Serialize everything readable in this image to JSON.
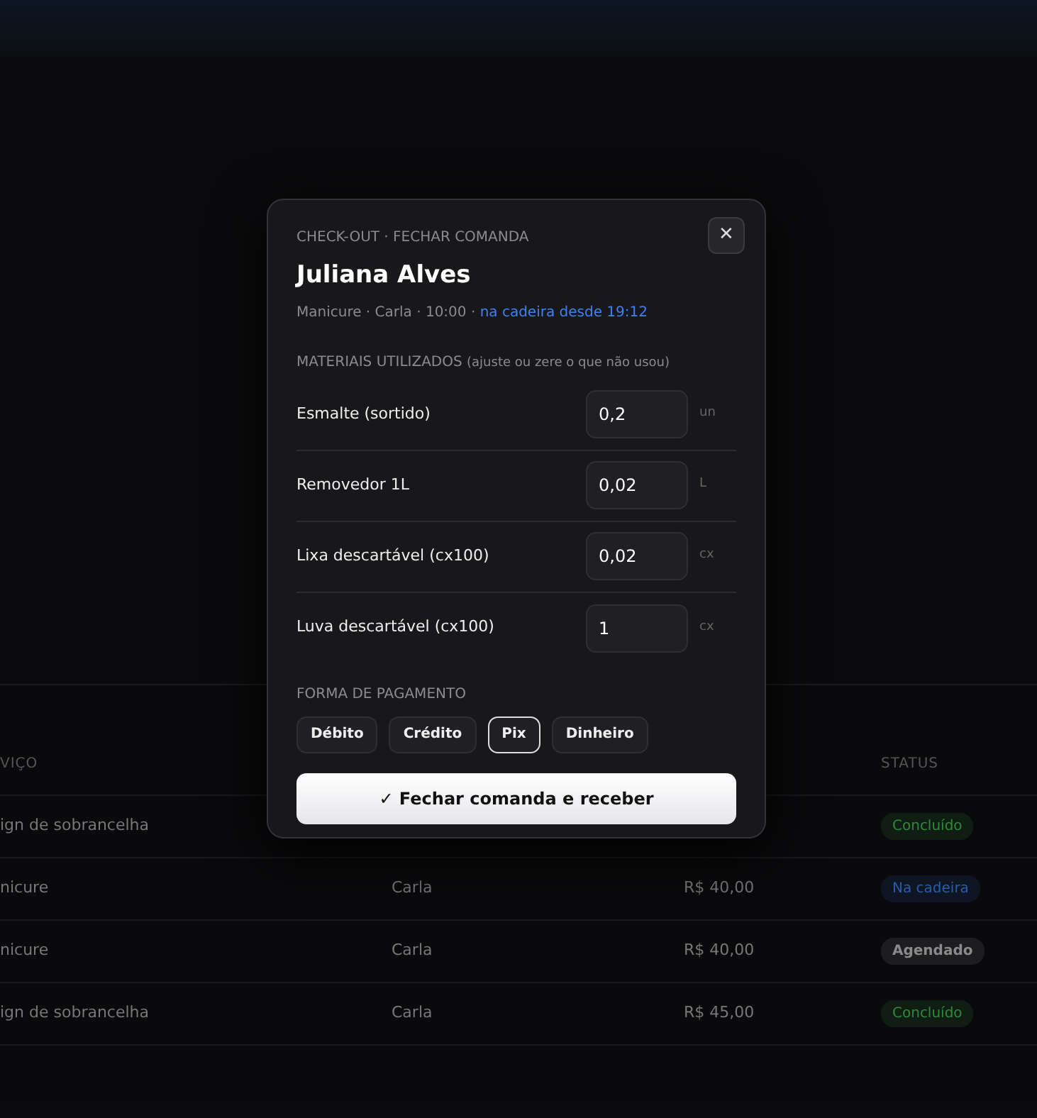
{
  "table": {
    "columns": [
      "VIÇO",
      "STATUS"
    ],
    "rows": [
      {
        "service": "ign de sobrancelha",
        "status": "Concluído",
        "color": "#2f8a3a"
      },
      {
        "service": "nicure",
        "professional": "Carla",
        "price": "R$ 40,00",
        "status": "Na cadeira",
        "color": "#2a5da8"
      },
      {
        "service": "nicure",
        "professional": "Carla",
        "price": "R$ 40,00",
        "status": "Agendado",
        "color": "#8a8a8a"
      },
      {
        "service": "ign de sobrancelha",
        "professional": "Carla",
        "price": "R$ 45,00",
        "status": "Concluído",
        "color": "#2f8a3a"
      }
    ]
  },
  "modal": {
    "kicker": "CHECK-OUT · FECHAR COMANDA",
    "close": "✕",
    "client": "Juliana Alves",
    "meta": "Manicure · Carla · 10:00 · ",
    "meta_highlight": "na cadeira desde 19:12",
    "materials_title": "MATERIAIS UTILIZADOS",
    "materials_hint": "(ajuste ou zere o que não usou)",
    "materials": [
      {
        "name": "Esmalte (sortido)",
        "value": "0,2",
        "unit": "un"
      },
      {
        "name": "Removedor 1L",
        "value": "0,02",
        "unit": "L"
      },
      {
        "name": "Lixa descartável (cx100)",
        "value": "0,02",
        "unit": "cx"
      },
      {
        "name": "Luva descartável (cx100)",
        "value": "1",
        "unit": "cx"
      }
    ],
    "payment_title": "FORMA DE PAGAMENTO",
    "payments": [
      {
        "label": "Débito",
        "selected": false
      },
      {
        "label": "Crédito",
        "selected": false
      },
      {
        "label": "Pix",
        "selected": true
      },
      {
        "label": "Dinheiro",
        "selected": false
      }
    ],
    "submit": "✓ Fechar comanda e receber"
  }
}
